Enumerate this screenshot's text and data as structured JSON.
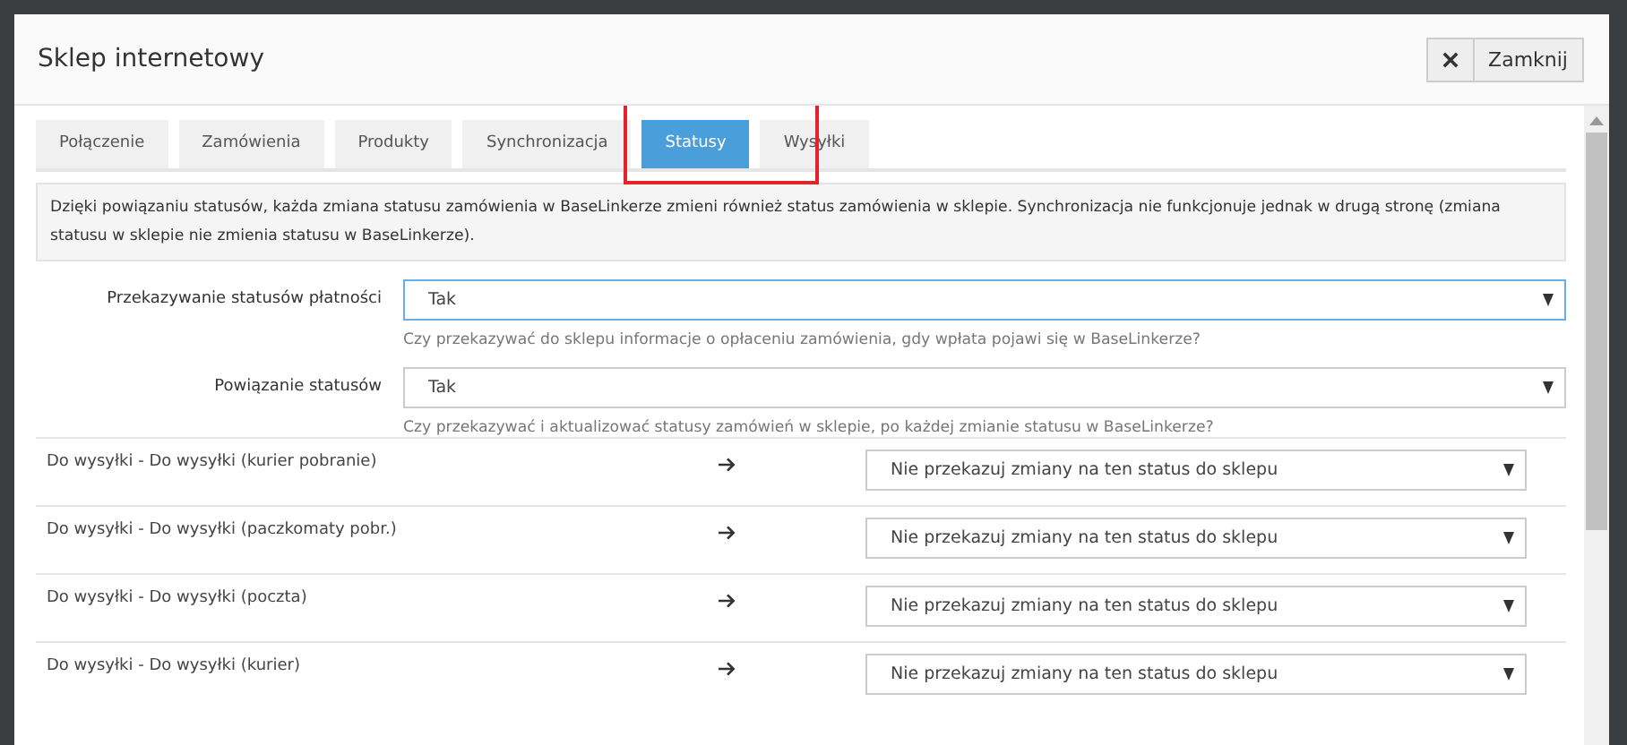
{
  "dialog": {
    "title": "Sklep internetowy",
    "close_button": "Zamknij"
  },
  "tabs": [
    {
      "label": "Połączenie",
      "selected": false
    },
    {
      "label": "Zamówienia",
      "selected": false
    },
    {
      "label": "Produkty",
      "selected": false
    },
    {
      "label": "Synchronizacja",
      "selected": false
    },
    {
      "label": "Statusy",
      "selected": true
    },
    {
      "label": "Wysyłki",
      "selected": false
    }
  ],
  "info": "Dzięki powiązaniu statusów, każda zmiana statusu zamówienia w BaseLinkerze zmieni również status zamówienia w sklepie. Synchronizacja nie funkcjonuje jednak w drugą stronę (zmiana statusu w sklepie nie zmienia statusu w BaseLinkerze).",
  "settings": [
    {
      "label": "Przekazywanie statusów płatności",
      "value": "Tak",
      "focused": true,
      "hint": "Czy przekazywać do sklepu informacje o opłaceniu zamówienia, gdy wpłata pojawi się w BaseLinkerze?"
    },
    {
      "label": "Powiązanie statusów",
      "value": "Tak",
      "focused": false,
      "hint": "Czy przekazywać i aktualizować statusy zamówień w sklepie, po każdej zmianie statusu w BaseLinkerze?"
    }
  ],
  "mappings": [
    {
      "status": "Do wysyłki - Do wysyłki (kurier pobranie)",
      "value": "Nie przekazuj zmiany na ten status do sklepu"
    },
    {
      "status": "Do wysyłki - Do wysyłki (paczkomaty pobr.)",
      "value": "Nie przekazuj zmiany na ten status do sklepu"
    },
    {
      "status": "Do wysyłki - Do wysyłki (poczta)",
      "value": "Nie przekazuj zmiany na ten status do sklepu"
    },
    {
      "status": "Do wysyłki - Do wysyłki (kurier)",
      "value": "Nie przekazuj zmiany na ten status do sklepu"
    }
  ]
}
